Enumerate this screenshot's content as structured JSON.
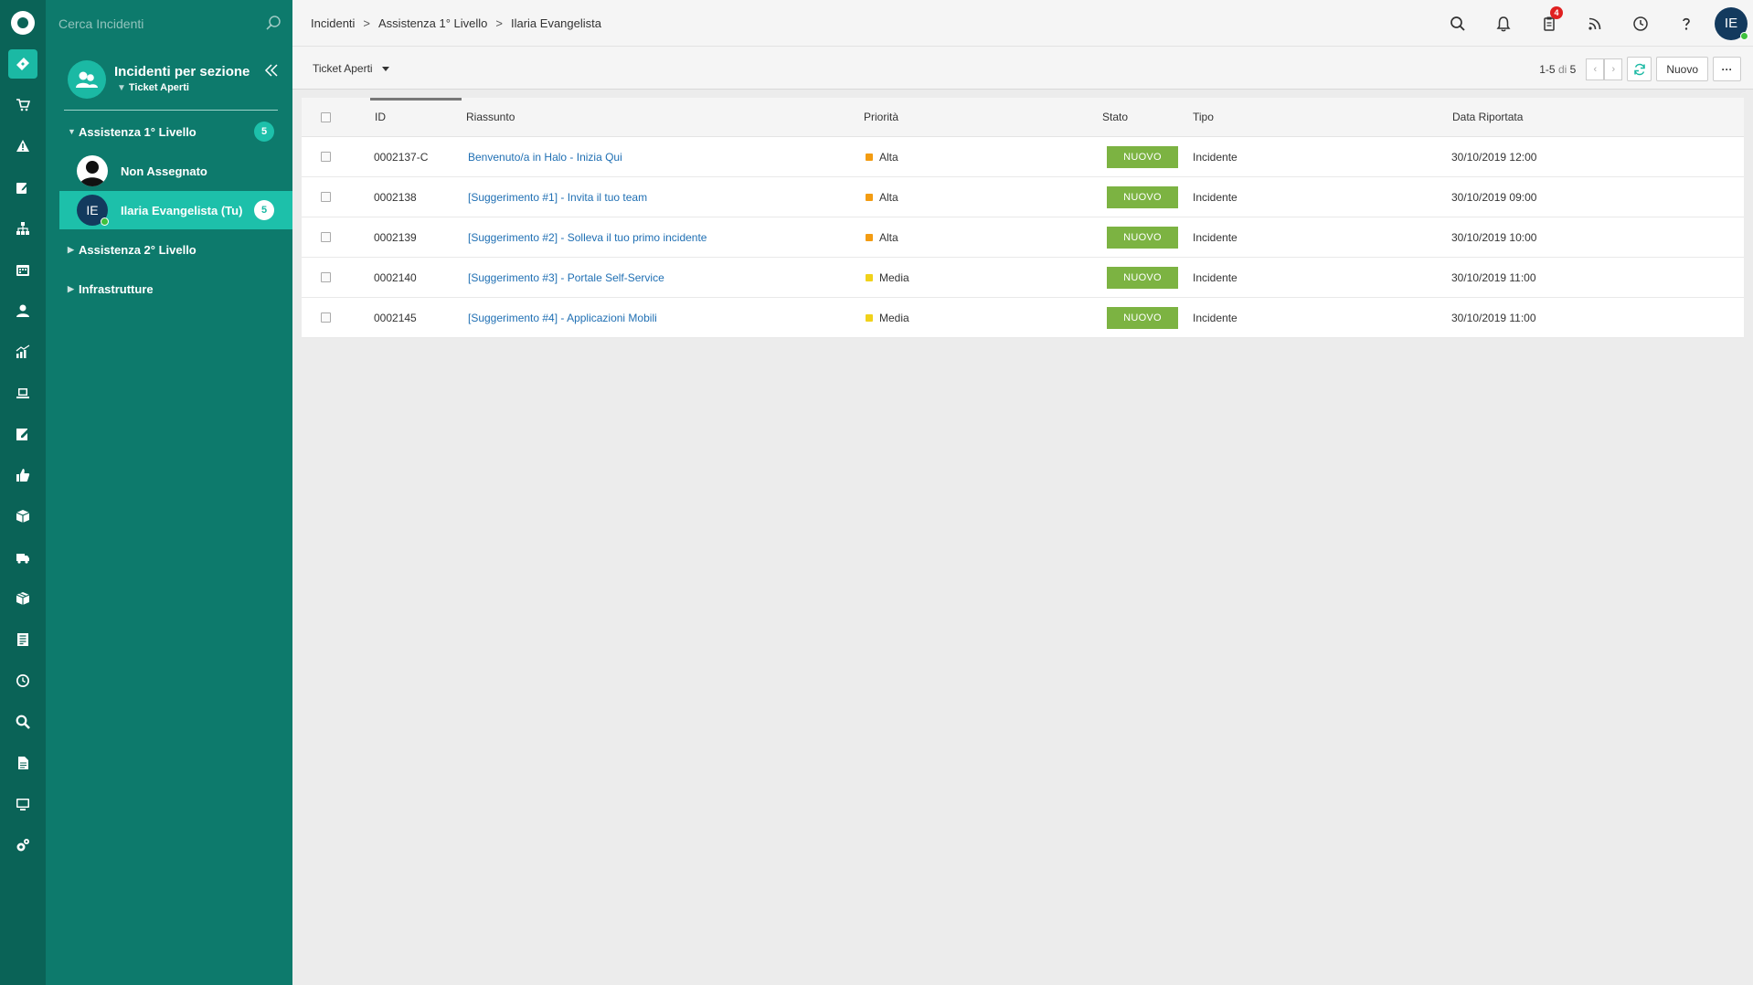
{
  "search": {
    "placeholder": "Cerca Incidenti"
  },
  "sidebar": {
    "title": "Incidenti per sezione",
    "filter": "Ticket Aperti",
    "groups": [
      {
        "label": "Assistenza 1° Livello",
        "count": "5",
        "expanded": true
      },
      {
        "label": "Assistenza 2° Livello",
        "expanded": false
      },
      {
        "label": "Infrastrutture",
        "expanded": false
      }
    ],
    "members": [
      {
        "label": "Non Assegnato"
      },
      {
        "label": "Ilaria Evangelista (Tu)",
        "initials": "IE",
        "count": "5",
        "active": true
      }
    ]
  },
  "breadcrumb": {
    "items": [
      "Incidenti",
      "Assistenza 1° Livello",
      "Ilaria Evangelista"
    ],
    "separator": ">"
  },
  "topbar": {
    "notification_count": "4",
    "user_initials": "IE"
  },
  "toolbar": {
    "view": "Ticket Aperti",
    "range": "1-5",
    "of_label": "di",
    "total": "5",
    "new_button": "Nuovo",
    "more_button": "···"
  },
  "table": {
    "columns": {
      "id": "ID",
      "summary": "Riassunto",
      "priority": "Priorità",
      "status": "Stato",
      "type": "Tipo",
      "reported": "Data Riportata"
    },
    "rows": [
      {
        "id": "0002137-C",
        "summary": "Benvenuto/a in Halo - Inizia Qui",
        "priority": "Alta",
        "status": "NUOVO",
        "type": "Incidente",
        "reported": "30/10/2019 12:00"
      },
      {
        "id": "0002138",
        "summary": "[Suggerimento #1] - Invita il tuo team",
        "priority": "Alta",
        "status": "NUOVO",
        "type": "Incidente",
        "reported": "30/10/2019 09:00"
      },
      {
        "id": "0002139",
        "summary": "[Suggerimento #2] - Solleva il tuo primo incidente",
        "priority": "Alta",
        "status": "NUOVO",
        "type": "Incidente",
        "reported": "30/10/2019 10:00"
      },
      {
        "id": "0002140",
        "summary": "[Suggerimento #3] - Portale Self-Service",
        "priority": "Media",
        "status": "NUOVO",
        "type": "Incidente",
        "reported": "30/10/2019 11:00"
      },
      {
        "id": "0002145",
        "summary": "[Suggerimento #4] - Applicazioni Mobili",
        "priority": "Media",
        "status": "NUOVO",
        "type": "Incidente",
        "reported": "30/10/2019 11:00"
      }
    ]
  },
  "colors": {
    "rail": "#0a6357",
    "sidebar": "#0d7a6c",
    "accent": "#1bb9a4",
    "priority_alta": "#f39c12",
    "priority_media": "#f1d21a",
    "status_nuovo": "#7cb342"
  },
  "rail_icons": [
    "ticket-icon",
    "cart-icon",
    "warning-icon",
    "edit-icon",
    "hierarchy-icon",
    "calendar-icon",
    "user-icon",
    "chart-icon",
    "laptop-icon",
    "note-icon",
    "thumbs-up-icon",
    "box-icon",
    "truck-icon",
    "package-icon",
    "document-icon",
    "clock-icon",
    "search-icon",
    "file-icon",
    "monitor-icon",
    "settings-icon"
  ]
}
